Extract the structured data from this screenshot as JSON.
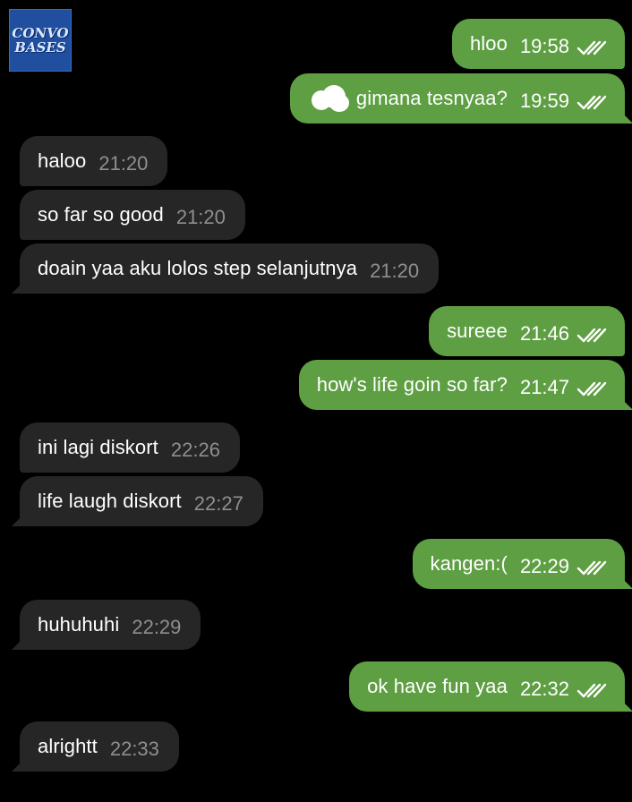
{
  "logo": {
    "text": "CONVO BASES"
  },
  "messages": [
    {
      "dir": "out",
      "text": "hloo",
      "time": "19:58",
      "read": true
    },
    {
      "dir": "out",
      "text": "gimana tesnyaa?",
      "time": "19:59",
      "read": true,
      "redacted_prefix": true
    },
    {
      "dir": "in",
      "text": "haloo",
      "time": "21:20"
    },
    {
      "dir": "in",
      "text": "so far so good",
      "time": "21:20"
    },
    {
      "dir": "in",
      "text": "doain yaa aku lolos step selanjutnya",
      "time": "21:20"
    },
    {
      "dir": "out",
      "text": "sureee",
      "time": "21:46",
      "read": true
    },
    {
      "dir": "out",
      "text": "how's life goin so far?",
      "time": "21:47",
      "read": true
    },
    {
      "dir": "in",
      "text": "ini lagi diskort",
      "time": "22:26"
    },
    {
      "dir": "in",
      "text": "life laugh diskort",
      "time": "22:27"
    },
    {
      "dir": "out",
      "text": "kangen:(",
      "time": "22:29",
      "read": true
    },
    {
      "dir": "in",
      "text": "huhuhuhi",
      "time": "22:29"
    },
    {
      "dir": "out",
      "text": "ok have fun yaa",
      "time": "22:32",
      "read": true
    },
    {
      "dir": "in",
      "text": "alrightt",
      "time": "22:33"
    }
  ],
  "colors": {
    "outgoing": "#5e9f43",
    "incoming": "#262626",
    "background": "#000000"
  },
  "icons": {
    "read_receipt": "double-check-icon"
  }
}
